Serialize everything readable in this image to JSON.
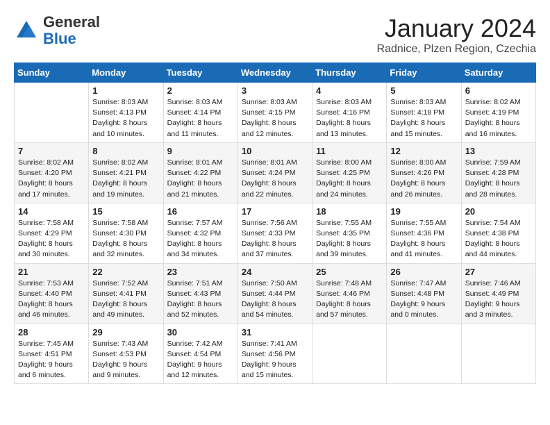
{
  "header": {
    "logo_general": "General",
    "logo_blue": "Blue",
    "month_title": "January 2024",
    "subtitle": "Radnice, Plzen Region, Czechia"
  },
  "days_of_week": [
    "Sunday",
    "Monday",
    "Tuesday",
    "Wednesday",
    "Thursday",
    "Friday",
    "Saturday"
  ],
  "weeks": [
    [
      {
        "day": "",
        "info": ""
      },
      {
        "day": "1",
        "info": "Sunrise: 8:03 AM\nSunset: 4:13 PM\nDaylight: 8 hours\nand 10 minutes."
      },
      {
        "day": "2",
        "info": "Sunrise: 8:03 AM\nSunset: 4:14 PM\nDaylight: 8 hours\nand 11 minutes."
      },
      {
        "day": "3",
        "info": "Sunrise: 8:03 AM\nSunset: 4:15 PM\nDaylight: 8 hours\nand 12 minutes."
      },
      {
        "day": "4",
        "info": "Sunrise: 8:03 AM\nSunset: 4:16 PM\nDaylight: 8 hours\nand 13 minutes."
      },
      {
        "day": "5",
        "info": "Sunrise: 8:03 AM\nSunset: 4:18 PM\nDaylight: 8 hours\nand 15 minutes."
      },
      {
        "day": "6",
        "info": "Sunrise: 8:02 AM\nSunset: 4:19 PM\nDaylight: 8 hours\nand 16 minutes."
      }
    ],
    [
      {
        "day": "7",
        "info": "Sunrise: 8:02 AM\nSunset: 4:20 PM\nDaylight: 8 hours\nand 17 minutes."
      },
      {
        "day": "8",
        "info": "Sunrise: 8:02 AM\nSunset: 4:21 PM\nDaylight: 8 hours\nand 19 minutes."
      },
      {
        "day": "9",
        "info": "Sunrise: 8:01 AM\nSunset: 4:22 PM\nDaylight: 8 hours\nand 21 minutes."
      },
      {
        "day": "10",
        "info": "Sunrise: 8:01 AM\nSunset: 4:24 PM\nDaylight: 8 hours\nand 22 minutes."
      },
      {
        "day": "11",
        "info": "Sunrise: 8:00 AM\nSunset: 4:25 PM\nDaylight: 8 hours\nand 24 minutes."
      },
      {
        "day": "12",
        "info": "Sunrise: 8:00 AM\nSunset: 4:26 PM\nDaylight: 8 hours\nand 26 minutes."
      },
      {
        "day": "13",
        "info": "Sunrise: 7:59 AM\nSunset: 4:28 PM\nDaylight: 8 hours\nand 28 minutes."
      }
    ],
    [
      {
        "day": "14",
        "info": "Sunrise: 7:58 AM\nSunset: 4:29 PM\nDaylight: 8 hours\nand 30 minutes."
      },
      {
        "day": "15",
        "info": "Sunrise: 7:58 AM\nSunset: 4:30 PM\nDaylight: 8 hours\nand 32 minutes."
      },
      {
        "day": "16",
        "info": "Sunrise: 7:57 AM\nSunset: 4:32 PM\nDaylight: 8 hours\nand 34 minutes."
      },
      {
        "day": "17",
        "info": "Sunrise: 7:56 AM\nSunset: 4:33 PM\nDaylight: 8 hours\nand 37 minutes."
      },
      {
        "day": "18",
        "info": "Sunrise: 7:55 AM\nSunset: 4:35 PM\nDaylight: 8 hours\nand 39 minutes."
      },
      {
        "day": "19",
        "info": "Sunrise: 7:55 AM\nSunset: 4:36 PM\nDaylight: 8 hours\nand 41 minutes."
      },
      {
        "day": "20",
        "info": "Sunrise: 7:54 AM\nSunset: 4:38 PM\nDaylight: 8 hours\nand 44 minutes."
      }
    ],
    [
      {
        "day": "21",
        "info": "Sunrise: 7:53 AM\nSunset: 4:40 PM\nDaylight: 8 hours\nand 46 minutes."
      },
      {
        "day": "22",
        "info": "Sunrise: 7:52 AM\nSunset: 4:41 PM\nDaylight: 8 hours\nand 49 minutes."
      },
      {
        "day": "23",
        "info": "Sunrise: 7:51 AM\nSunset: 4:43 PM\nDaylight: 8 hours\nand 52 minutes."
      },
      {
        "day": "24",
        "info": "Sunrise: 7:50 AM\nSunset: 4:44 PM\nDaylight: 8 hours\nand 54 minutes."
      },
      {
        "day": "25",
        "info": "Sunrise: 7:48 AM\nSunset: 4:46 PM\nDaylight: 8 hours\nand 57 minutes."
      },
      {
        "day": "26",
        "info": "Sunrise: 7:47 AM\nSunset: 4:48 PM\nDaylight: 9 hours\nand 0 minutes."
      },
      {
        "day": "27",
        "info": "Sunrise: 7:46 AM\nSunset: 4:49 PM\nDaylight: 9 hours\nand 3 minutes."
      }
    ],
    [
      {
        "day": "28",
        "info": "Sunrise: 7:45 AM\nSunset: 4:51 PM\nDaylight: 9 hours\nand 6 minutes."
      },
      {
        "day": "29",
        "info": "Sunrise: 7:43 AM\nSunset: 4:53 PM\nDaylight: 9 hours\nand 9 minutes."
      },
      {
        "day": "30",
        "info": "Sunrise: 7:42 AM\nSunset: 4:54 PM\nDaylight: 9 hours\nand 12 minutes."
      },
      {
        "day": "31",
        "info": "Sunrise: 7:41 AM\nSunset: 4:56 PM\nDaylight: 9 hours\nand 15 minutes."
      },
      {
        "day": "",
        "info": ""
      },
      {
        "day": "",
        "info": ""
      },
      {
        "day": "",
        "info": ""
      }
    ]
  ]
}
